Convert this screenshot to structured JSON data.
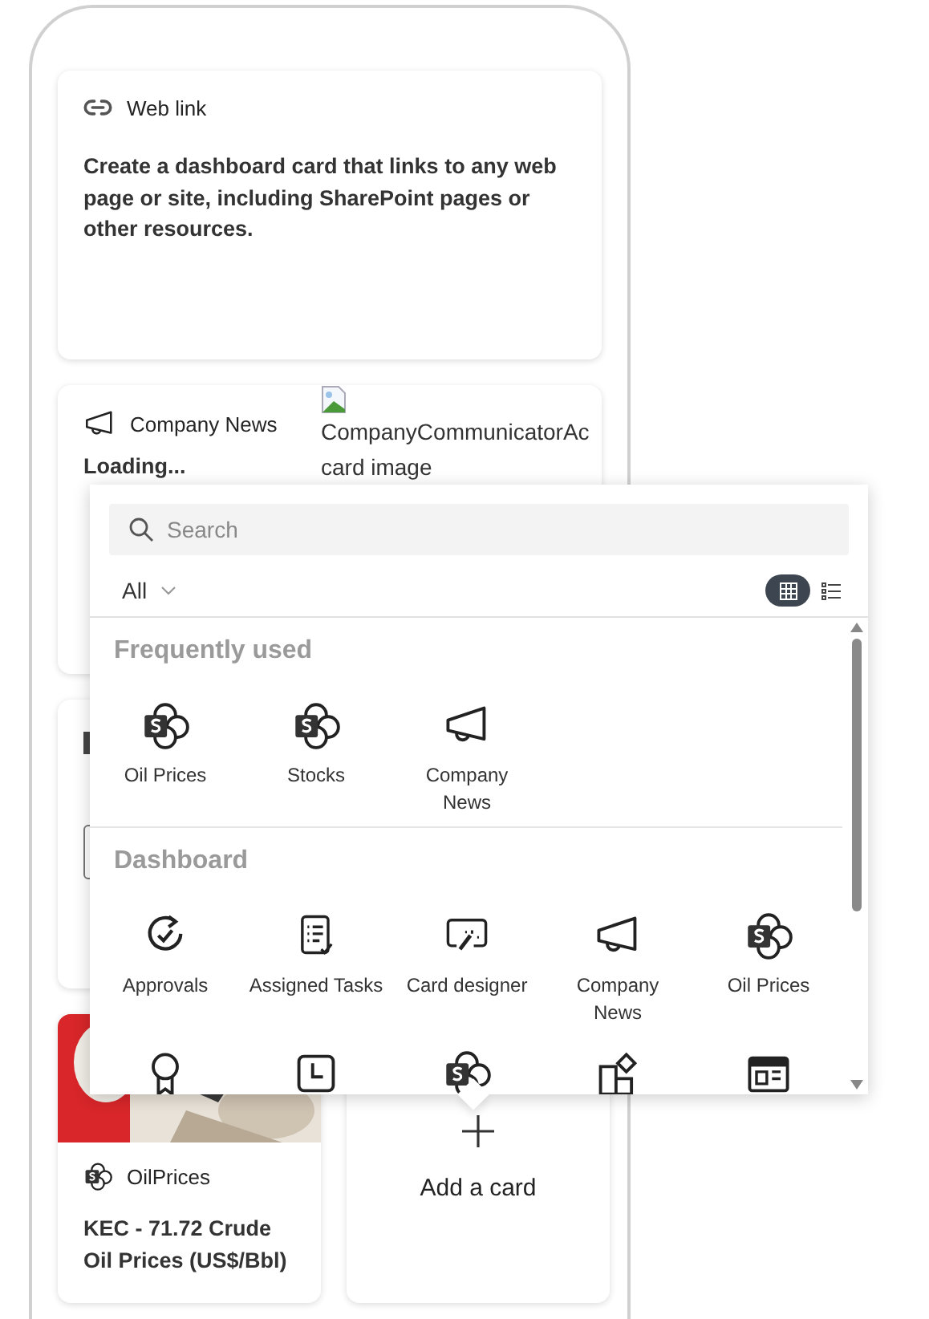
{
  "cards": [
    {
      "kind": "text",
      "title": "Web link",
      "body": "Create a dashboard card that links to any web page or site, including SharePoint pages or other resources."
    },
    {
      "kind": "news",
      "title": "Company News",
      "body": "Loading...",
      "image_alt": "CompanyCommunicatorAc card image"
    },
    {
      "kind": "partial"
    }
  ],
  "bottom_cards": [
    {
      "title": "OilPrices",
      "body": "KEC - 71.72 Crude Oil Prices (US$/Bbl)"
    },
    {
      "kind": "add",
      "label": "Add a card"
    }
  ],
  "picker": {
    "search": {
      "placeholder": "Search"
    },
    "filter": {
      "value": "All"
    },
    "view_modes": [
      {
        "kind": "grid",
        "selected": true
      },
      {
        "kind": "list",
        "selected": false
      }
    ],
    "sections": [
      {
        "title": "Frequently used",
        "items": [
          {
            "kind": "sharepoint",
            "label": "Oil Prices"
          },
          {
            "kind": "sharepoint",
            "label": "Stocks"
          },
          {
            "kind": "megaphone",
            "label": "Company News"
          }
        ]
      },
      {
        "title": "Dashboard",
        "items": [
          {
            "kind": "approvals",
            "label": "Approvals"
          },
          {
            "kind": "tasks",
            "label": "Assigned Tasks"
          },
          {
            "kind": "designer",
            "label": "Card designer"
          },
          {
            "kind": "megaphone",
            "label": "Company News"
          },
          {
            "kind": "sharepoint",
            "label": "Oil Prices"
          },
          {
            "kind": "award"
          },
          {
            "kind": "clock"
          },
          {
            "kind": "sharepoint"
          },
          {
            "kind": "apps"
          },
          {
            "kind": "newspaper"
          }
        ]
      }
    ]
  }
}
